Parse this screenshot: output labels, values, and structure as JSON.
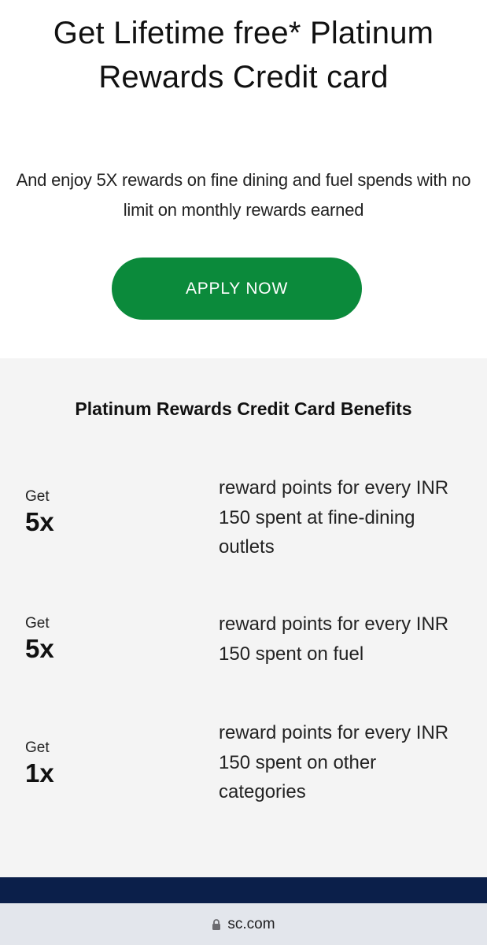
{
  "hero": {
    "title": "Get Lifetime free* Platinum Rewards Credit card",
    "subtitle": "And enjoy 5X rewards on fine dining and fuel spends with no limit on monthly rewards earned",
    "apply_label": "APPLY NOW"
  },
  "benefits": {
    "title": "Platinum Rewards Credit Card Benefits",
    "items": [
      {
        "get": "Get",
        "multiplier": "5x",
        "description": "reward points for every INR 150 spent at fine-dining outlets"
      },
      {
        "get": "Get",
        "multiplier": "5x",
        "description": "reward points for every INR 150 spent on fuel"
      },
      {
        "get": "Get",
        "multiplier": "1x",
        "description": "reward points for every INR 150 spent on other categories"
      }
    ]
  },
  "browser": {
    "url": "sc.com",
    "lock_icon": "lock-icon"
  },
  "colors": {
    "apply_button": "#0b8a3b",
    "benefits_background": "#f4f4f4",
    "footer_bar": "#0b1f4a",
    "url_bar": "#e3e6ec"
  }
}
